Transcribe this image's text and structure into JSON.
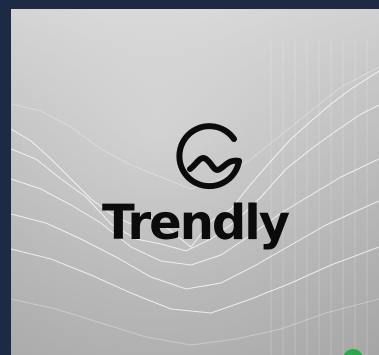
{
  "brand": {
    "name": "Trendly",
    "logo_icon": "trendly-logo-icon"
  },
  "colors": {
    "frame": "#1c2a44",
    "text": "#0b0b0b",
    "badge": "#2ea44f"
  }
}
